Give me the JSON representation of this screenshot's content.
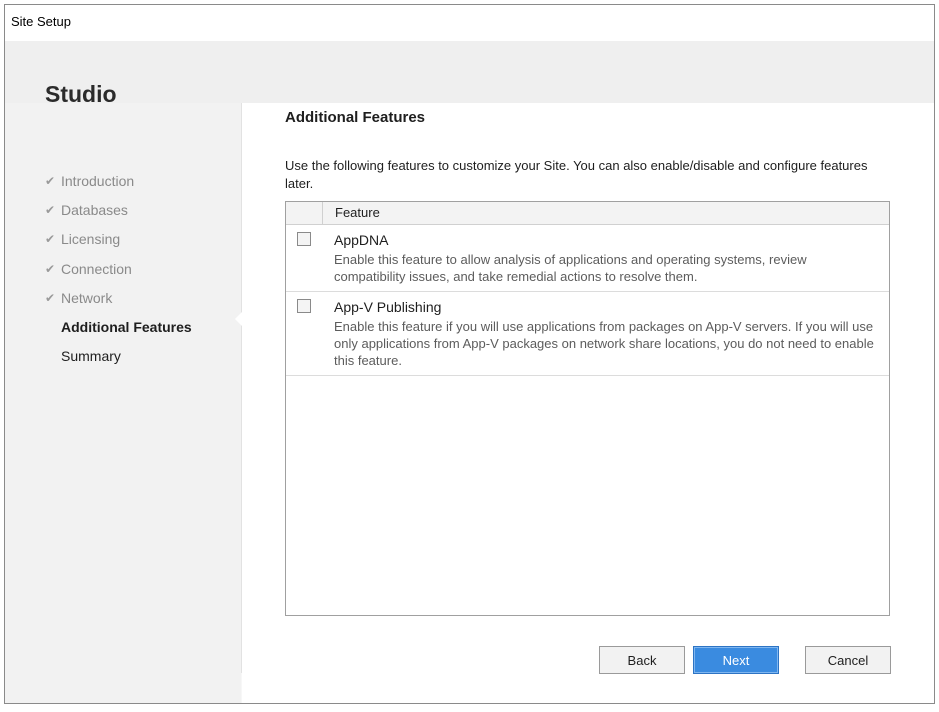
{
  "window": {
    "title": "Site Setup"
  },
  "sidebar": {
    "brand": "Studio",
    "steps": [
      {
        "label": "Introduction",
        "status": "done"
      },
      {
        "label": "Databases",
        "status": "done"
      },
      {
        "label": "Licensing",
        "status": "done"
      },
      {
        "label": "Connection",
        "status": "done"
      },
      {
        "label": "Network",
        "status": "done"
      },
      {
        "label": "Additional Features",
        "status": "current"
      },
      {
        "label": "Summary",
        "status": "pending"
      }
    ]
  },
  "main": {
    "title": "Additional Features",
    "description": "Use the following features to customize your Site.  You can also enable/disable and configure features later.",
    "table": {
      "column_header": "Feature",
      "rows": [
        {
          "name": "AppDNA",
          "description": "Enable this feature to allow analysis of applications and operating systems, review compatibility issues, and take remedial actions to resolve them.",
          "checked": false
        },
        {
          "name": "App-V Publishing",
          "description": "Enable this feature if you will use applications from packages on App-V servers. If you will use only applications from App-V packages on network share locations, you do not need to enable this feature.",
          "checked": false
        }
      ]
    }
  },
  "buttons": {
    "back": "Back",
    "next": "Next",
    "cancel": "Cancel"
  },
  "icons": {
    "done_step": "checkmark-icon"
  },
  "colors": {
    "primary_button": "#3a8be0",
    "current_step_text": "#1e1e1e",
    "done_step_text": "#8a8a8a"
  }
}
